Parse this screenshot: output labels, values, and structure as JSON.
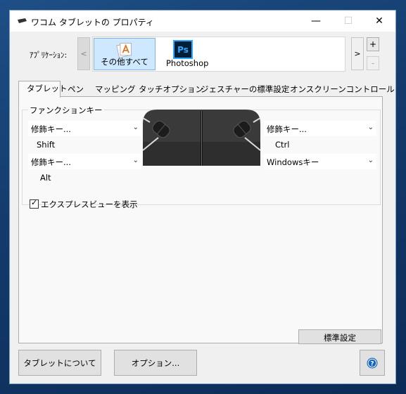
{
  "window": {
    "title": "ワコム タブレットの プロパティ",
    "minimize_glyph": "—",
    "maximize_glyph": "☐",
    "close_glyph": "✕"
  },
  "application": {
    "label": "ｱﾌﾟﾘｹｰｼｮﾝ:",
    "scroll_left": "<",
    "scroll_right": ">",
    "add_button": "+",
    "remove_button": "-",
    "apps": [
      {
        "label": "その他すべて",
        "selected": true,
        "icon": "all-apps-icon"
      },
      {
        "label": "Photoshop",
        "selected": false,
        "icon": "photoshop-icon",
        "icon_text": "Ps"
      }
    ]
  },
  "tabs": [
    {
      "label": "タブレット",
      "active": true
    },
    {
      "label": "ペン"
    },
    {
      "label": "マッピング"
    },
    {
      "label": "タッチオプション"
    },
    {
      "label": "ジェスチャーの標準設定"
    },
    {
      "label": "オンスクリーンコントロール"
    }
  ],
  "function_keys": {
    "group_title": "ファンクションキー",
    "left_top": {
      "dropdown": "修飾キー...",
      "value": "Shift"
    },
    "left_bottom": {
      "dropdown": "修飾キー...",
      "value": "Alt"
    },
    "right_top": {
      "dropdown": "修飾キー...",
      "value": "Ctrl"
    },
    "right_bottom": {
      "dropdown": "Windowsキー"
    },
    "chevron": "⌄"
  },
  "express_view": {
    "label": "エクスプレスビューを表示",
    "checked": true,
    "mark": "✓"
  },
  "buttons": {
    "default": "標準設定",
    "about_tablet": "タブレットについて",
    "options": "オプション...",
    "help": "?"
  },
  "colors": {
    "selected_tile": "#cde8ff",
    "help_icon": "#1565c0",
    "desktop": "#123a6a"
  }
}
